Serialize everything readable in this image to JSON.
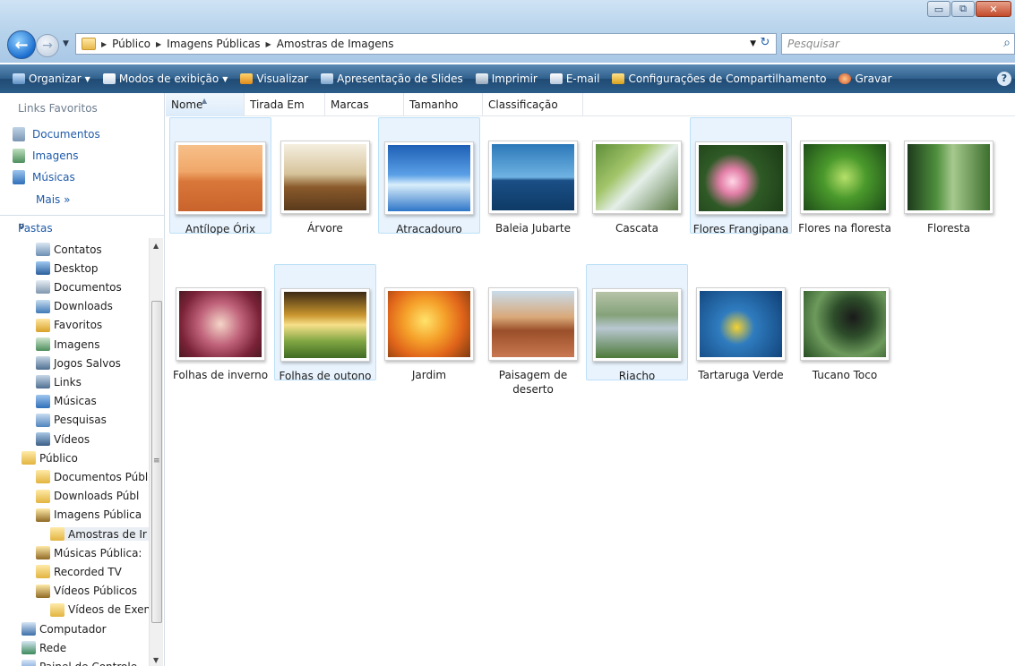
{
  "window": {
    "minimize": "▭",
    "maximize": "⧉",
    "close": "✕"
  },
  "address": {
    "crumbs": [
      "Público",
      "Imagens Públicas",
      "Amostras de Imagens"
    ]
  },
  "search": {
    "placeholder": "Pesquisar"
  },
  "toolbar": {
    "items": [
      {
        "label": "Organizar",
        "dropdown": true,
        "icon": "organize-icon"
      },
      {
        "label": "Modos de exibição",
        "dropdown": true,
        "icon": "views-icon"
      },
      {
        "label": "Visualizar",
        "dropdown": false,
        "icon": "preview-icon"
      },
      {
        "label": "Apresentação de Slides",
        "dropdown": false,
        "icon": "slideshow-icon"
      },
      {
        "label": "Imprimir",
        "dropdown": false,
        "icon": "print-icon"
      },
      {
        "label": "E-mail",
        "dropdown": false,
        "icon": "email-icon"
      },
      {
        "label": "Configurações de Compartilhamento",
        "dropdown": false,
        "icon": "share-icon"
      },
      {
        "label": "Gravar",
        "dropdown": false,
        "icon": "burn-icon"
      }
    ]
  },
  "favorites": {
    "title": "Links Favoritos",
    "items": [
      "Documentos",
      "Imagens",
      "Músicas"
    ],
    "more": "Mais »"
  },
  "folders": {
    "title": "Pastas",
    "items": [
      {
        "label": "Contatos",
        "indent": 1
      },
      {
        "label": "Desktop",
        "indent": 1
      },
      {
        "label": "Documentos",
        "indent": 1
      },
      {
        "label": "Downloads",
        "indent": 1
      },
      {
        "label": "Favoritos",
        "indent": 1
      },
      {
        "label": "Imagens",
        "indent": 1
      },
      {
        "label": "Jogos Salvos",
        "indent": 1
      },
      {
        "label": "Links",
        "indent": 1
      },
      {
        "label": "Músicas",
        "indent": 1
      },
      {
        "label": "Pesquisas",
        "indent": 1
      },
      {
        "label": "Vídeos",
        "indent": 1
      },
      {
        "label": "Público",
        "indent": 0
      },
      {
        "label": "Documentos Públ",
        "indent": 1
      },
      {
        "label": "Downloads Públ",
        "indent": 1
      },
      {
        "label": "Imagens Pública",
        "indent": 1
      },
      {
        "label": "Amostras de Ir",
        "indent": 2
      },
      {
        "label": "Músicas Pública:",
        "indent": 1
      },
      {
        "label": "Recorded TV",
        "indent": 1
      },
      {
        "label": "Vídeos Públicos",
        "indent": 1
      },
      {
        "label": "Vídeos de Exen",
        "indent": 2
      },
      {
        "label": "Computador",
        "indent": 0
      },
      {
        "label": "Rede",
        "indent": 0
      },
      {
        "label": "Painel de Controle",
        "indent": 0
      }
    ]
  },
  "columns": [
    "Nome",
    "Tirada Em",
    "Marcas",
    "Tamanho",
    "Classificação"
  ],
  "images": [
    {
      "name": "Antílope Órix",
      "selected": true
    },
    {
      "name": "Árvore",
      "selected": false
    },
    {
      "name": "Atracadouro",
      "selected": true
    },
    {
      "name": "Baleia Jubarte",
      "selected": false
    },
    {
      "name": "Cascata",
      "selected": false
    },
    {
      "name": "Flores Frangipana",
      "selected": true
    },
    {
      "name": "Flores na floresta",
      "selected": false
    },
    {
      "name": "Floresta",
      "selected": false
    },
    {
      "name": "Folhas de inverno",
      "selected": false
    },
    {
      "name": "Folhas de outono",
      "selected": true
    },
    {
      "name": "Jardim",
      "selected": false
    },
    {
      "name": "Paisagem de deserto",
      "selected": false
    },
    {
      "name": "Riacho",
      "selected": true
    },
    {
      "name": "Tartaruga Verde",
      "selected": false
    },
    {
      "name": "Tucano Toco",
      "selected": false
    }
  ]
}
